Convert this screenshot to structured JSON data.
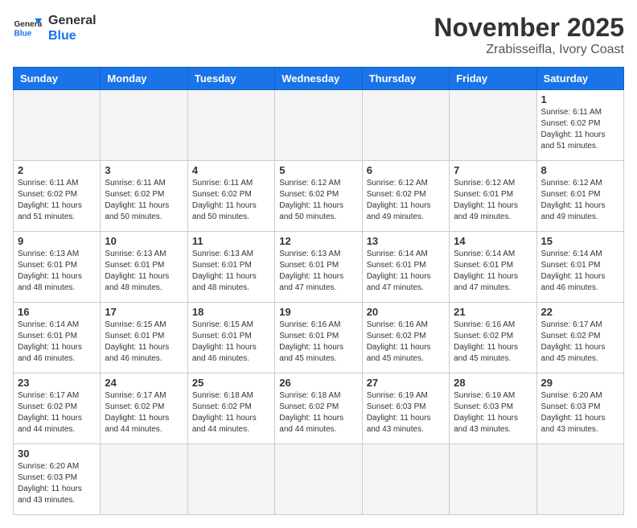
{
  "header": {
    "logo_general": "General",
    "logo_blue": "Blue",
    "month_title": "November 2025",
    "location": "Zrabisseifla, Ivory Coast"
  },
  "days_of_week": [
    "Sunday",
    "Monday",
    "Tuesday",
    "Wednesday",
    "Thursday",
    "Friday",
    "Saturday"
  ],
  "weeks": [
    [
      {
        "day": "",
        "info": ""
      },
      {
        "day": "",
        "info": ""
      },
      {
        "day": "",
        "info": ""
      },
      {
        "day": "",
        "info": ""
      },
      {
        "day": "",
        "info": ""
      },
      {
        "day": "",
        "info": ""
      },
      {
        "day": "1",
        "info": "Sunrise: 6:11 AM\nSunset: 6:02 PM\nDaylight: 11 hours\nand 51 minutes."
      }
    ],
    [
      {
        "day": "2",
        "info": "Sunrise: 6:11 AM\nSunset: 6:02 PM\nDaylight: 11 hours\nand 51 minutes."
      },
      {
        "day": "3",
        "info": "Sunrise: 6:11 AM\nSunset: 6:02 PM\nDaylight: 11 hours\nand 50 minutes."
      },
      {
        "day": "4",
        "info": "Sunrise: 6:11 AM\nSunset: 6:02 PM\nDaylight: 11 hours\nand 50 minutes."
      },
      {
        "day": "5",
        "info": "Sunrise: 6:12 AM\nSunset: 6:02 PM\nDaylight: 11 hours\nand 50 minutes."
      },
      {
        "day": "6",
        "info": "Sunrise: 6:12 AM\nSunset: 6:02 PM\nDaylight: 11 hours\nand 49 minutes."
      },
      {
        "day": "7",
        "info": "Sunrise: 6:12 AM\nSunset: 6:01 PM\nDaylight: 11 hours\nand 49 minutes."
      },
      {
        "day": "8",
        "info": "Sunrise: 6:12 AM\nSunset: 6:01 PM\nDaylight: 11 hours\nand 49 minutes."
      }
    ],
    [
      {
        "day": "9",
        "info": "Sunrise: 6:13 AM\nSunset: 6:01 PM\nDaylight: 11 hours\nand 48 minutes."
      },
      {
        "day": "10",
        "info": "Sunrise: 6:13 AM\nSunset: 6:01 PM\nDaylight: 11 hours\nand 48 minutes."
      },
      {
        "day": "11",
        "info": "Sunrise: 6:13 AM\nSunset: 6:01 PM\nDaylight: 11 hours\nand 48 minutes."
      },
      {
        "day": "12",
        "info": "Sunrise: 6:13 AM\nSunset: 6:01 PM\nDaylight: 11 hours\nand 47 minutes."
      },
      {
        "day": "13",
        "info": "Sunrise: 6:14 AM\nSunset: 6:01 PM\nDaylight: 11 hours\nand 47 minutes."
      },
      {
        "day": "14",
        "info": "Sunrise: 6:14 AM\nSunset: 6:01 PM\nDaylight: 11 hours\nand 47 minutes."
      },
      {
        "day": "15",
        "info": "Sunrise: 6:14 AM\nSunset: 6:01 PM\nDaylight: 11 hours\nand 46 minutes."
      }
    ],
    [
      {
        "day": "16",
        "info": "Sunrise: 6:14 AM\nSunset: 6:01 PM\nDaylight: 11 hours\nand 46 minutes."
      },
      {
        "day": "17",
        "info": "Sunrise: 6:15 AM\nSunset: 6:01 PM\nDaylight: 11 hours\nand 46 minutes."
      },
      {
        "day": "18",
        "info": "Sunrise: 6:15 AM\nSunset: 6:01 PM\nDaylight: 11 hours\nand 46 minutes."
      },
      {
        "day": "19",
        "info": "Sunrise: 6:16 AM\nSunset: 6:01 PM\nDaylight: 11 hours\nand 45 minutes."
      },
      {
        "day": "20",
        "info": "Sunrise: 6:16 AM\nSunset: 6:02 PM\nDaylight: 11 hours\nand 45 minutes."
      },
      {
        "day": "21",
        "info": "Sunrise: 6:16 AM\nSunset: 6:02 PM\nDaylight: 11 hours\nand 45 minutes."
      },
      {
        "day": "22",
        "info": "Sunrise: 6:17 AM\nSunset: 6:02 PM\nDaylight: 11 hours\nand 45 minutes."
      }
    ],
    [
      {
        "day": "23",
        "info": "Sunrise: 6:17 AM\nSunset: 6:02 PM\nDaylight: 11 hours\nand 44 minutes."
      },
      {
        "day": "24",
        "info": "Sunrise: 6:17 AM\nSunset: 6:02 PM\nDaylight: 11 hours\nand 44 minutes."
      },
      {
        "day": "25",
        "info": "Sunrise: 6:18 AM\nSunset: 6:02 PM\nDaylight: 11 hours\nand 44 minutes."
      },
      {
        "day": "26",
        "info": "Sunrise: 6:18 AM\nSunset: 6:02 PM\nDaylight: 11 hours\nand 44 minutes."
      },
      {
        "day": "27",
        "info": "Sunrise: 6:19 AM\nSunset: 6:03 PM\nDaylight: 11 hours\nand 43 minutes."
      },
      {
        "day": "28",
        "info": "Sunrise: 6:19 AM\nSunset: 6:03 PM\nDaylight: 11 hours\nand 43 minutes."
      },
      {
        "day": "29",
        "info": "Sunrise: 6:20 AM\nSunset: 6:03 PM\nDaylight: 11 hours\nand 43 minutes."
      }
    ],
    [
      {
        "day": "30",
        "info": "Sunrise: 6:20 AM\nSunset: 6:03 PM\nDaylight: 11 hours\nand 43 minutes."
      },
      {
        "day": "",
        "info": ""
      },
      {
        "day": "",
        "info": ""
      },
      {
        "day": "",
        "info": ""
      },
      {
        "day": "",
        "info": ""
      },
      {
        "day": "",
        "info": ""
      },
      {
        "day": "",
        "info": ""
      }
    ]
  ]
}
